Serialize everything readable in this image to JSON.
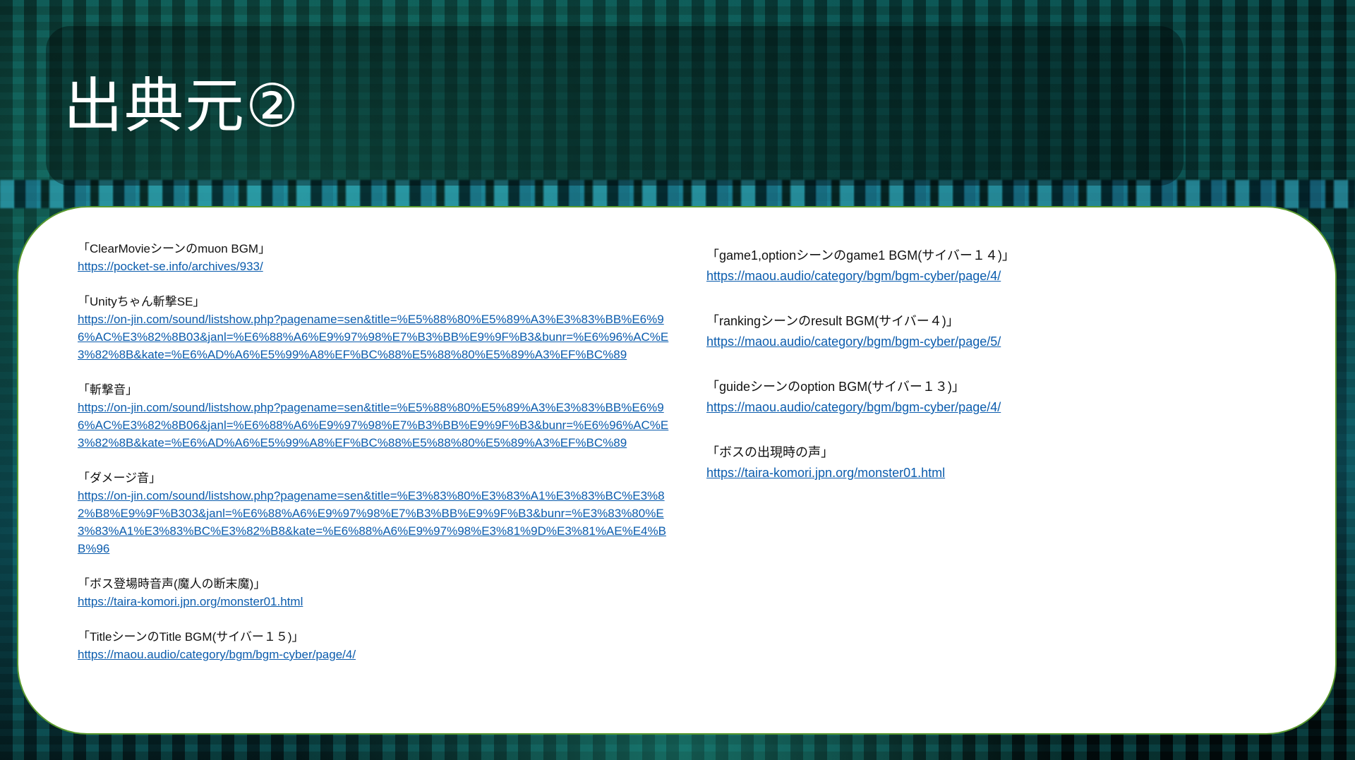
{
  "slide": {
    "title": "出典元②"
  },
  "left_entries": [
    {
      "label": "「ClearMovieシーンのmuon BGM」",
      "url": "https://pocket-se.info/archives/933/"
    },
    {
      "label": "「Unityちゃん斬撃SE」",
      "url": "https://on-jin.com/sound/listshow.php?pagename=sen&title=%E5%88%80%E5%89%A3%E3%83%BB%E6%96%AC%E3%82%8B03&janl=%E6%88%A6%E9%97%98%E7%B3%BB%E9%9F%B3&bunr=%E6%96%AC%E3%82%8B&kate=%E6%AD%A6%E5%99%A8%EF%BC%88%E5%88%80%E5%89%A3%EF%BC%89"
    },
    {
      "label": "「斬撃音」",
      "url": "https://on-jin.com/sound/listshow.php?pagename=sen&title=%E5%88%80%E5%89%A3%E3%83%BB%E6%96%AC%E3%82%8B06&janl=%E6%88%A6%E9%97%98%E7%B3%BB%E9%9F%B3&bunr=%E6%96%AC%E3%82%8B&kate=%E6%AD%A6%E5%99%A8%EF%BC%88%E5%88%80%E5%89%A3%EF%BC%89"
    },
    {
      "label": "「ダメージ音」",
      "url": "https://on-jin.com/sound/listshow.php?pagename=sen&title=%E3%83%80%E3%83%A1%E3%83%BC%E3%82%B8%E9%9F%B303&janl=%E6%88%A6%E9%97%98%E7%B3%BB%E9%9F%B3&bunr=%E3%83%80%E3%83%A1%E3%83%BC%E3%82%B8&kate=%E6%88%A6%E9%97%98%E3%81%9D%E3%81%AE%E4%BB%96"
    },
    {
      "label": "「ボス登場時音声(魔人の断末魔)」",
      "url": "https://taira-komori.jpn.org/monster01.html"
    },
    {
      "label": "「TitleシーンのTitle BGM(サイバー１５)」",
      "url": "https://maou.audio/category/bgm/bgm-cyber/page/4/"
    }
  ],
  "right_entries": [
    {
      "label": "「game1,optionシーンのgame1 BGM(サイバー１４)」",
      "url": "https://maou.audio/category/bgm/bgm-cyber/page/4/"
    },
    {
      "label": "「rankingシーンのresult BGM(サイバー４)」",
      "url": "https://maou.audio/category/bgm/bgm-cyber/page/5/"
    },
    {
      "label": "「guideシーンのoption BGM(サイバー１３)」",
      "url": "https://maou.audio/category/bgm/bgm-cyber/page/4/"
    },
    {
      "label": "「ボスの出現時の声」",
      "url": "https://taira-komori.jpn.org/monster01.html"
    }
  ],
  "colors": {
    "link": "#0b5cad",
    "card_border": "#5a9a2e",
    "title_text": "#ffffff"
  }
}
